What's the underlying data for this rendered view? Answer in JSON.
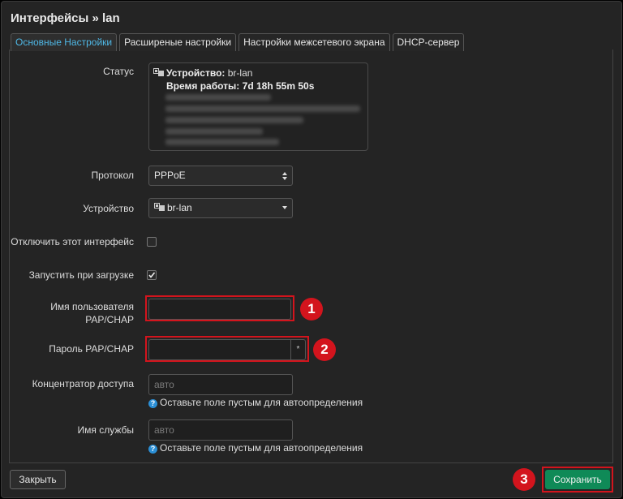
{
  "title": "Интерфейсы » lan",
  "tabs": [
    {
      "label": "Основные Настройки",
      "active": true
    },
    {
      "label": "Расширеные настройки",
      "active": false
    },
    {
      "label": "Настройки межсетевого экрана",
      "active": false
    },
    {
      "label": "DHCP-сервер",
      "active": false
    }
  ],
  "status": {
    "label": "Статус",
    "device_key": "Устройство:",
    "device_value": "br-lan",
    "uptime_key": "Время работы:",
    "uptime_value": "7d 18h 55m 50s"
  },
  "protocol": {
    "label": "Протокол",
    "value": "PPPoE"
  },
  "device": {
    "label": "Устройство",
    "value": "br-lan"
  },
  "disable_iface": {
    "label": "Отключить этот интерфейс",
    "checked": false
  },
  "autostart": {
    "label": "Запустить при загрузке",
    "checked": true
  },
  "username": {
    "label_line1": "Имя пользователя",
    "label_line2": "PAP/CHAP",
    "value": ""
  },
  "password": {
    "label": "Пароль PAP/CHAP",
    "value": "",
    "toggle": "*"
  },
  "ac": {
    "label": "Концентратор доступа",
    "placeholder": "авто",
    "help": "Оставьте поле пустым для автоопределения"
  },
  "service": {
    "label": "Имя службы",
    "placeholder": "авто",
    "help": "Оставьте поле пустым для автоопределения"
  },
  "buttons": {
    "close": "Закрыть",
    "save": "Сохранить"
  },
  "badges": [
    "1",
    "2",
    "3"
  ],
  "colors": {
    "accent_tab": "#4fb8e6",
    "highlight": "#d3141d",
    "save": "#0f8a57",
    "help": "#2b8fd6"
  }
}
